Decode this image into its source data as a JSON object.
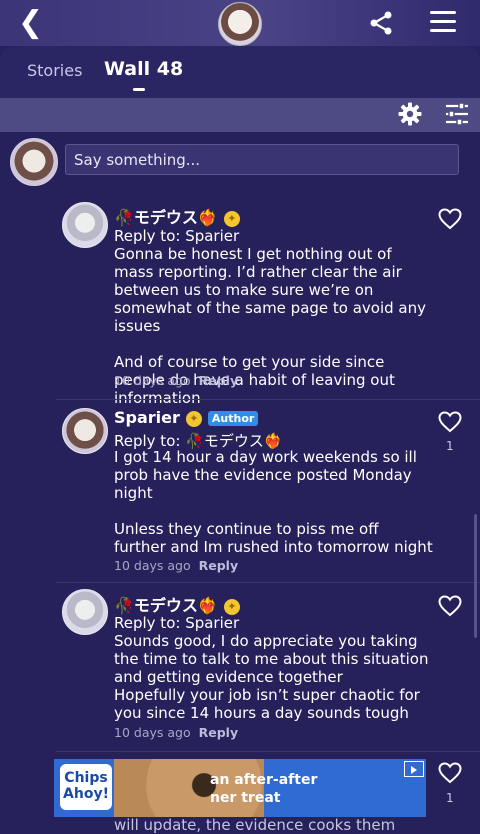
{
  "header": {
    "back_icon": "chevron-left-icon",
    "share_icon": "share-icon",
    "menu_icon": "hamburger-menu-icon"
  },
  "tabs": [
    {
      "label": "Stories",
      "active": false
    },
    {
      "label": "Wall 48",
      "active": true
    }
  ],
  "toolbar": {
    "settings_icon": "gear-icon",
    "filter_icon": "sliders-icon"
  },
  "composer": {
    "placeholder": "Say something..."
  },
  "comments": [
    {
      "author": "🥀モデウス❤️‍🔥",
      "reply_to": "Reply to: Sparier",
      "text": "Gonna be honest I get nothing out of mass reporting. I’d rather clear the air between us to make sure we’re on somewhat of the same page to avoid any issues\n\nAnd of course to get your side since people do have a habit of leaving out information",
      "time": "10 days ago",
      "reply_label": "Reply",
      "likes": ""
    },
    {
      "author": "Sparier",
      "author_badge": "Author",
      "reply_to": "Reply to: 🥀モデウス❤️‍🔥",
      "text": "I got 14 hour a day work weekends so ill prob have the evidence posted Monday night\n\nUnless they continue to piss me off further and Im rushed into tomorrow night",
      "time": "10 days ago",
      "reply_label": "Reply",
      "likes": "1"
    },
    {
      "author": "🥀モデウス❤️‍🔥",
      "reply_to": "Reply to: Sparier",
      "text": "Sounds good, I do appreciate you taking the time to talk to me about this situation and getting evidence together\nHopefully your job isn’t super chaotic for you since 14 hours a day sounds tough",
      "time": "10 days ago",
      "reply_label": "Reply",
      "likes": ""
    }
  ],
  "ad": {
    "brand": "Chips Ahoy!",
    "text_line1": "an after-after",
    "text_line2": "ner treat"
  },
  "partial_comment": {
    "likes": "1",
    "text": "will update, the evidence cooks them"
  },
  "colors": {
    "background": "#26215a",
    "author_badge": "#2f8fe6",
    "level_badge": "#f3c531"
  }
}
